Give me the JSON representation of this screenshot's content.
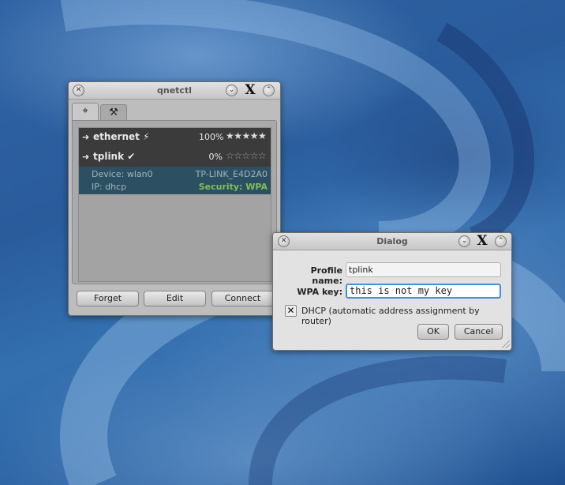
{
  "desktop": {
    "background": "#2f63a3"
  },
  "qnetctl": {
    "title": "qnetctl",
    "tabs": [
      {
        "icon": "crosshair-icon",
        "glyph": "⌖"
      },
      {
        "icon": "tools-icon",
        "glyph": "⚒"
      }
    ],
    "networks": [
      {
        "arrow": "➜",
        "name": "ethernet ⚡",
        "percent": "100%",
        "stars": "★★★★★"
      },
      {
        "arrow": "➜",
        "name": "tplink ✔",
        "percent": "0%",
        "stars": "☆☆☆☆☆"
      }
    ],
    "details": {
      "device": "Device: wlan0",
      "ip": "IP: dhcp",
      "ssid": "TP-LINK_E4D2A0",
      "security": "Security: WPA"
    },
    "buttons": {
      "forget": "Forget",
      "edit": "Edit",
      "connect": "Connect"
    }
  },
  "dialog": {
    "title": "Dialog",
    "profile_label": "Profile name:",
    "profile_value": "tplink",
    "wpa_label": "WPA key:",
    "wpa_value": "this is not my key",
    "dhcp_check": "✕",
    "dhcp_label": "DHCP (automatic address assignment by router)",
    "ok": "OK",
    "cancel": "Cancel"
  },
  "titlebar_glyphs": {
    "close": "✕",
    "minimize": "⌄",
    "maximize": "⌃",
    "x": "X"
  }
}
